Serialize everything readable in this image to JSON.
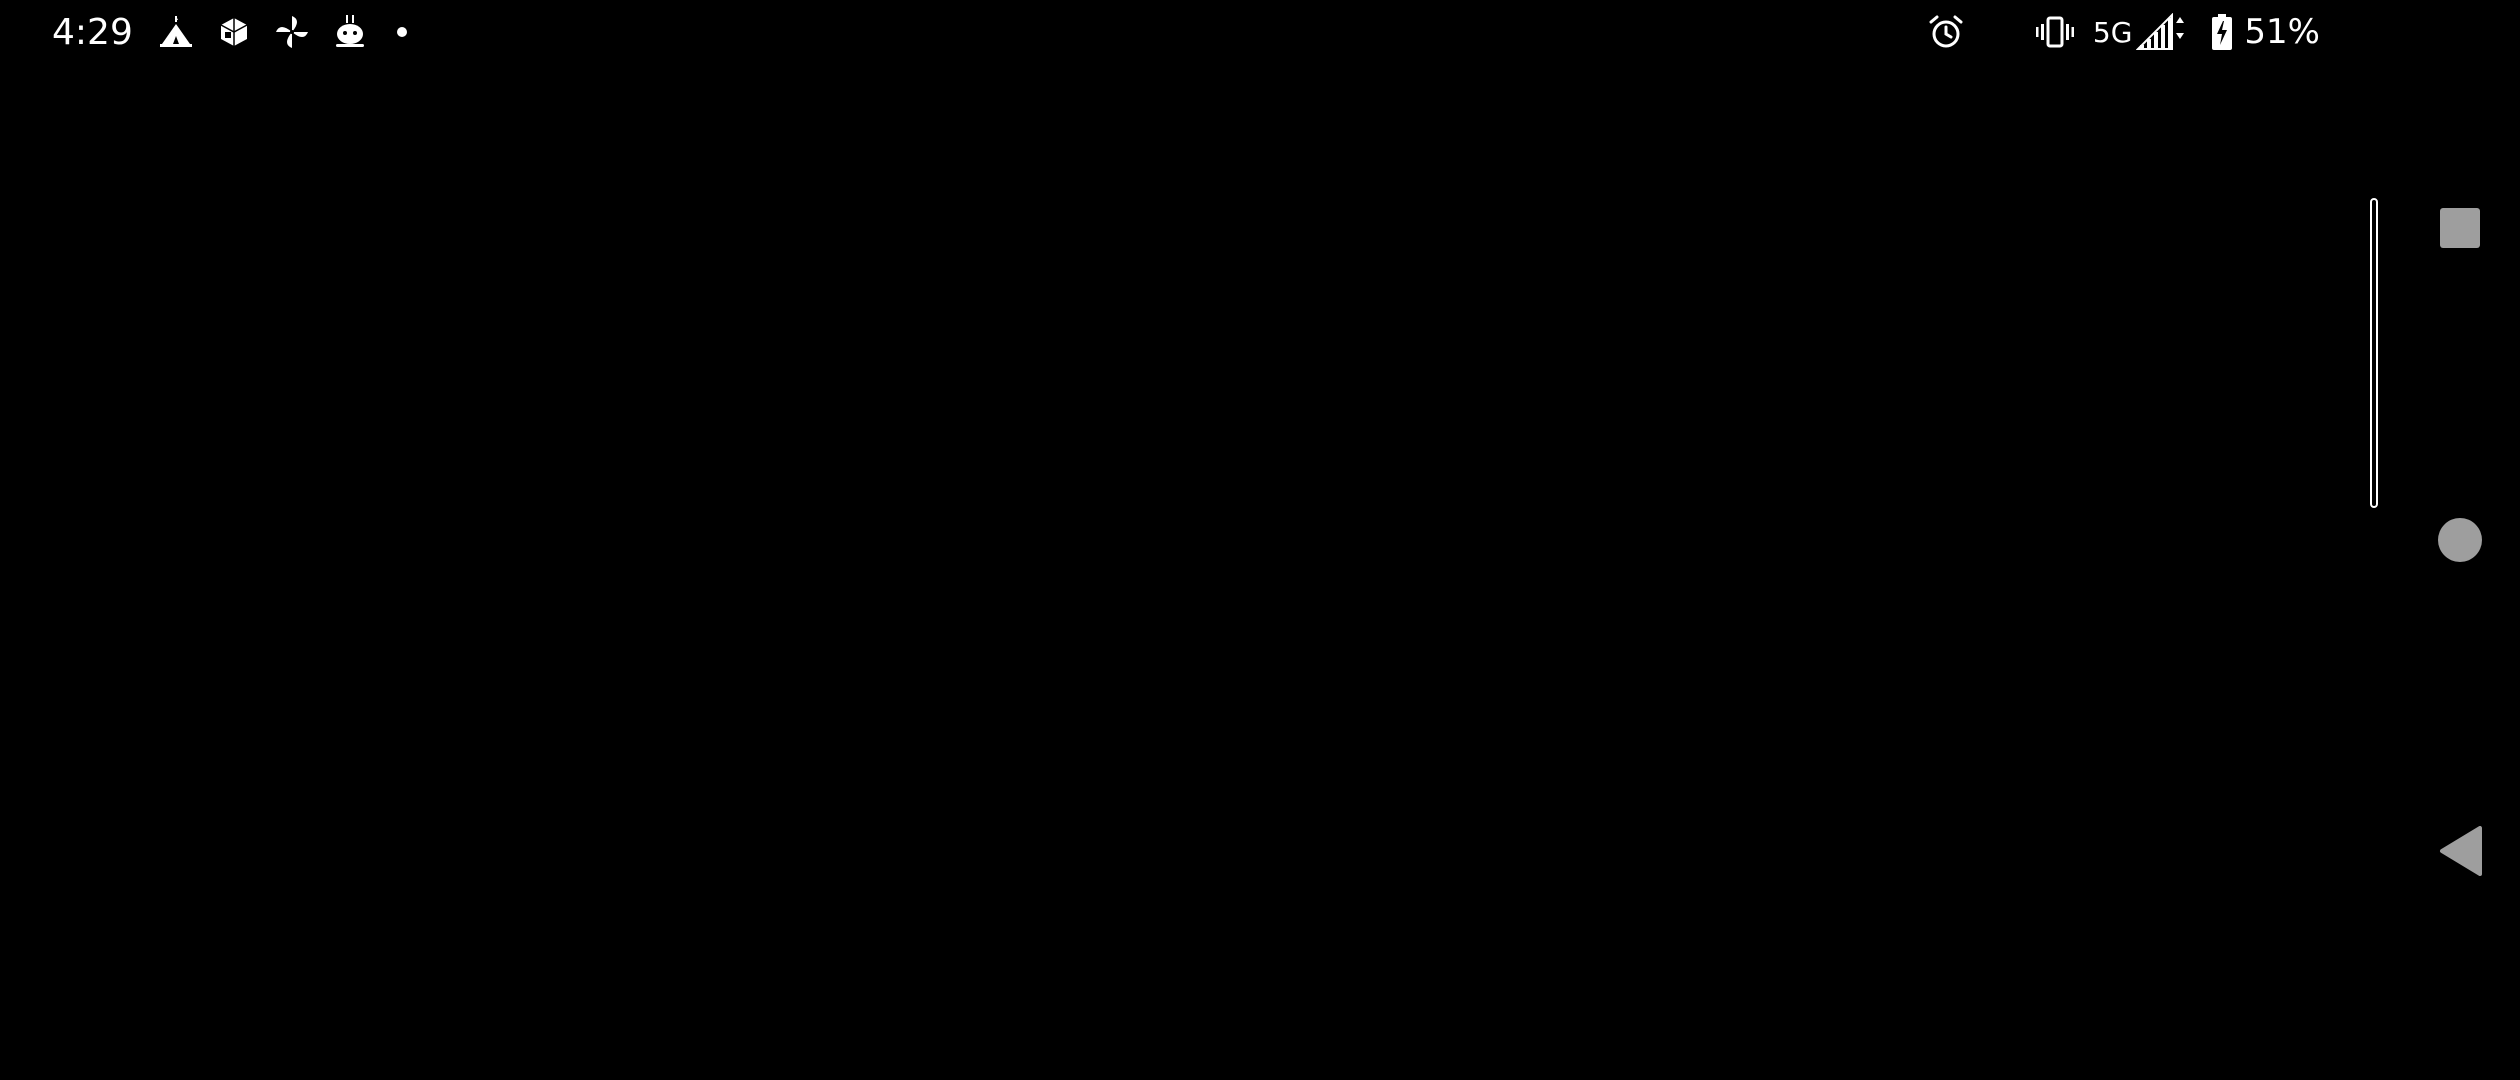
{
  "status_bar": {
    "time": "4:29",
    "notification_icons": [
      "tent-icon",
      "cube-icon",
      "pinwheel-icon",
      "robot-icon"
    ],
    "network": "5G",
    "battery_percent": "51%"
  },
  "nav_bar": {
    "buttons": [
      "recent-apps",
      "home",
      "back"
    ],
    "button_color": "#9e9e9e"
  },
  "colors": {
    "background": "#000000",
    "foreground": "#ffffff"
  }
}
